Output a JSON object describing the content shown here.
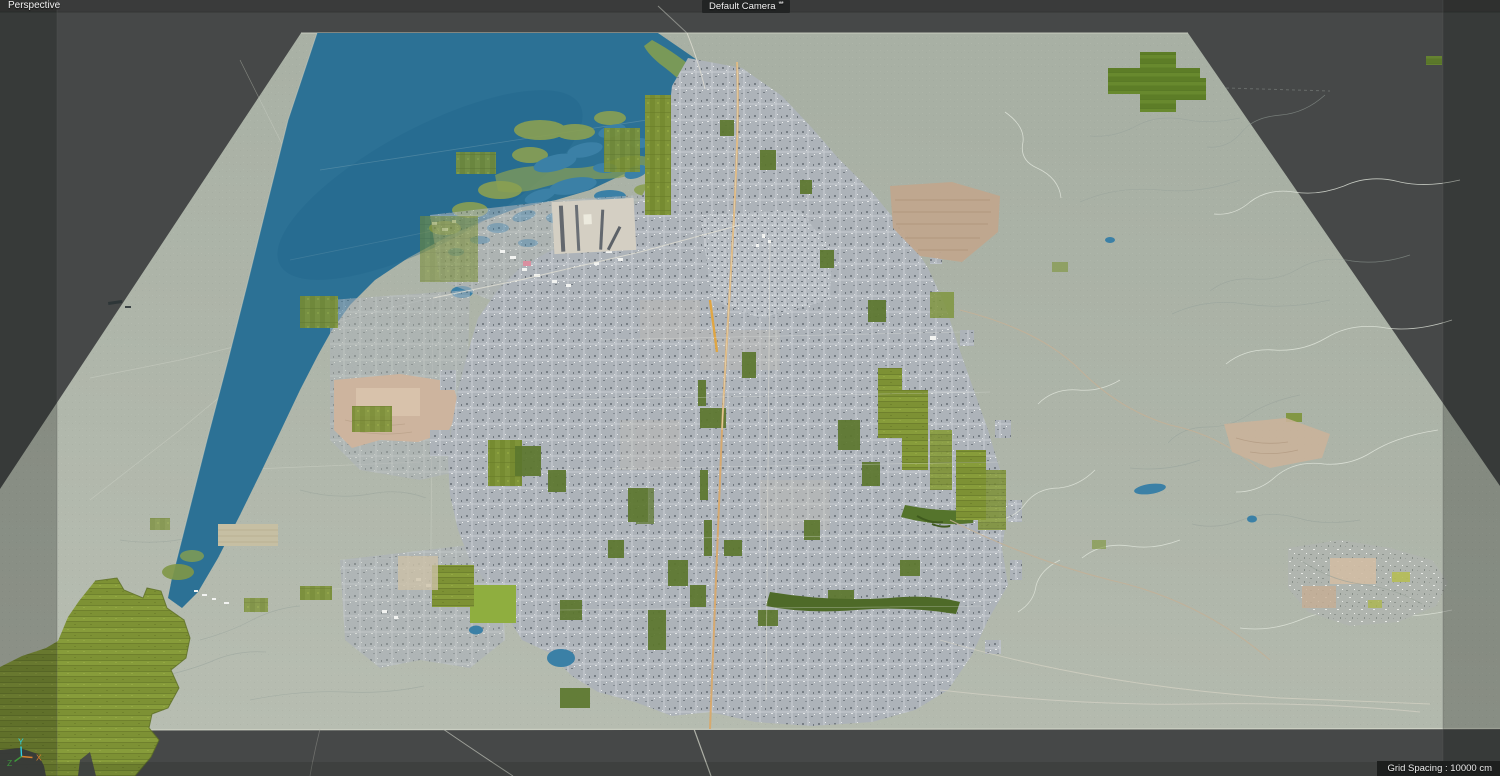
{
  "viewport": {
    "view_label": "Perspective",
    "camera_label": "Default Camera",
    "camera_badge": "**",
    "status_bar": {
      "grid_spacing": "Grid Spacing : 10000 cm"
    }
  },
  "axis_gizmo": {
    "x_label": "X",
    "y_label": "Y",
    "z_label": "Z"
  },
  "scene": {
    "description_labels": [],
    "map_subject": "city terrain model with lake, urban grid, farmland and mountains"
  },
  "colors": {
    "header_bar": "#3a3b3b",
    "viewport_bg": "#464848",
    "outer_shade": "rgba(14,18,16,0.26)",
    "plane_top": "#a8b0a4",
    "plane_bottom": "#b7bdb1",
    "plane_edge": "#ced2c5",
    "lake": "#2c7195",
    "lake_deep": "#1f658a",
    "pond": "#3b80a6",
    "marsh_green": "#8aa052",
    "farm_green": "#7d9439",
    "park_green": "#5c772e",
    "bright_green": "#8fae3f",
    "hill_grass": "#7d9134",
    "ne_green": "#5d7d27",
    "city": "#adb3b9",
    "salmon": "#cdb49e",
    "mountain_tan": "#c0a68d",
    "stream": "#e3e8de",
    "contour": "#97a29b",
    "road_light": "#e6e3d7",
    "road_tan": "#d8a96b",
    "label_bg": "#222424",
    "status_bg": "#1d1f1e",
    "text": "#f2f2f2",
    "axis_x": "#d9822f",
    "axis_y": "#2fd0e2",
    "axis_z": "#3fa23c"
  }
}
